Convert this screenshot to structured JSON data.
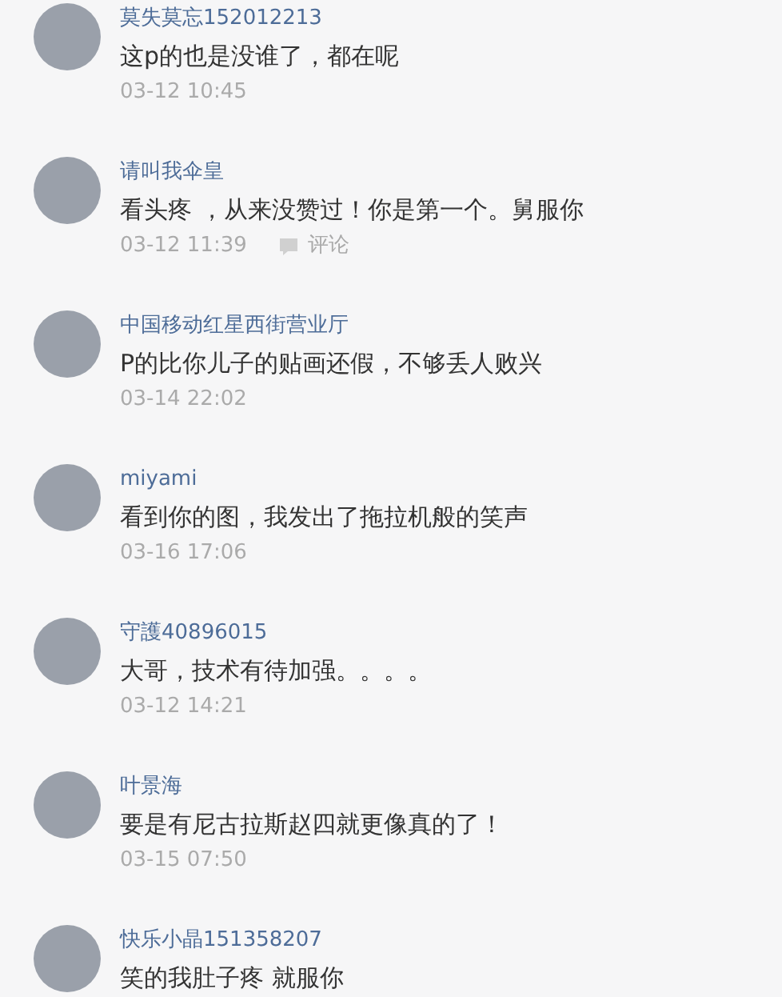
{
  "comments": [
    {
      "author": "莫失莫忘152012213",
      "text": "这p的也是没谁了，都在呢",
      "time": "03-12 10:45"
    },
    {
      "author": "请叫我伞皇",
      "text": "看头疼 ，从来没赞过！你是第一个。舅服你",
      "time": "03-12 11:39",
      "reply_label": "评论"
    },
    {
      "author": "中国移动红星西街营业厅",
      "text": "P的比你儿子的贴画还假，不够丢人败兴",
      "time": "03-14 22:02"
    },
    {
      "author": "miyami",
      "text": "看到你的图，我发出了拖拉机般的笑声",
      "time": "03-16 17:06"
    },
    {
      "author": "守護40896015",
      "text": "大哥，技术有待加强。。。。",
      "time": "03-12 14:21"
    },
    {
      "author": "叶景海",
      "text": "要是有尼古拉斯赵四就更像真的了！",
      "time": "03-15 07:50"
    },
    {
      "author": "快乐小晶151358207",
      "text": "笑的我肚子疼 就服你"
    }
  ]
}
